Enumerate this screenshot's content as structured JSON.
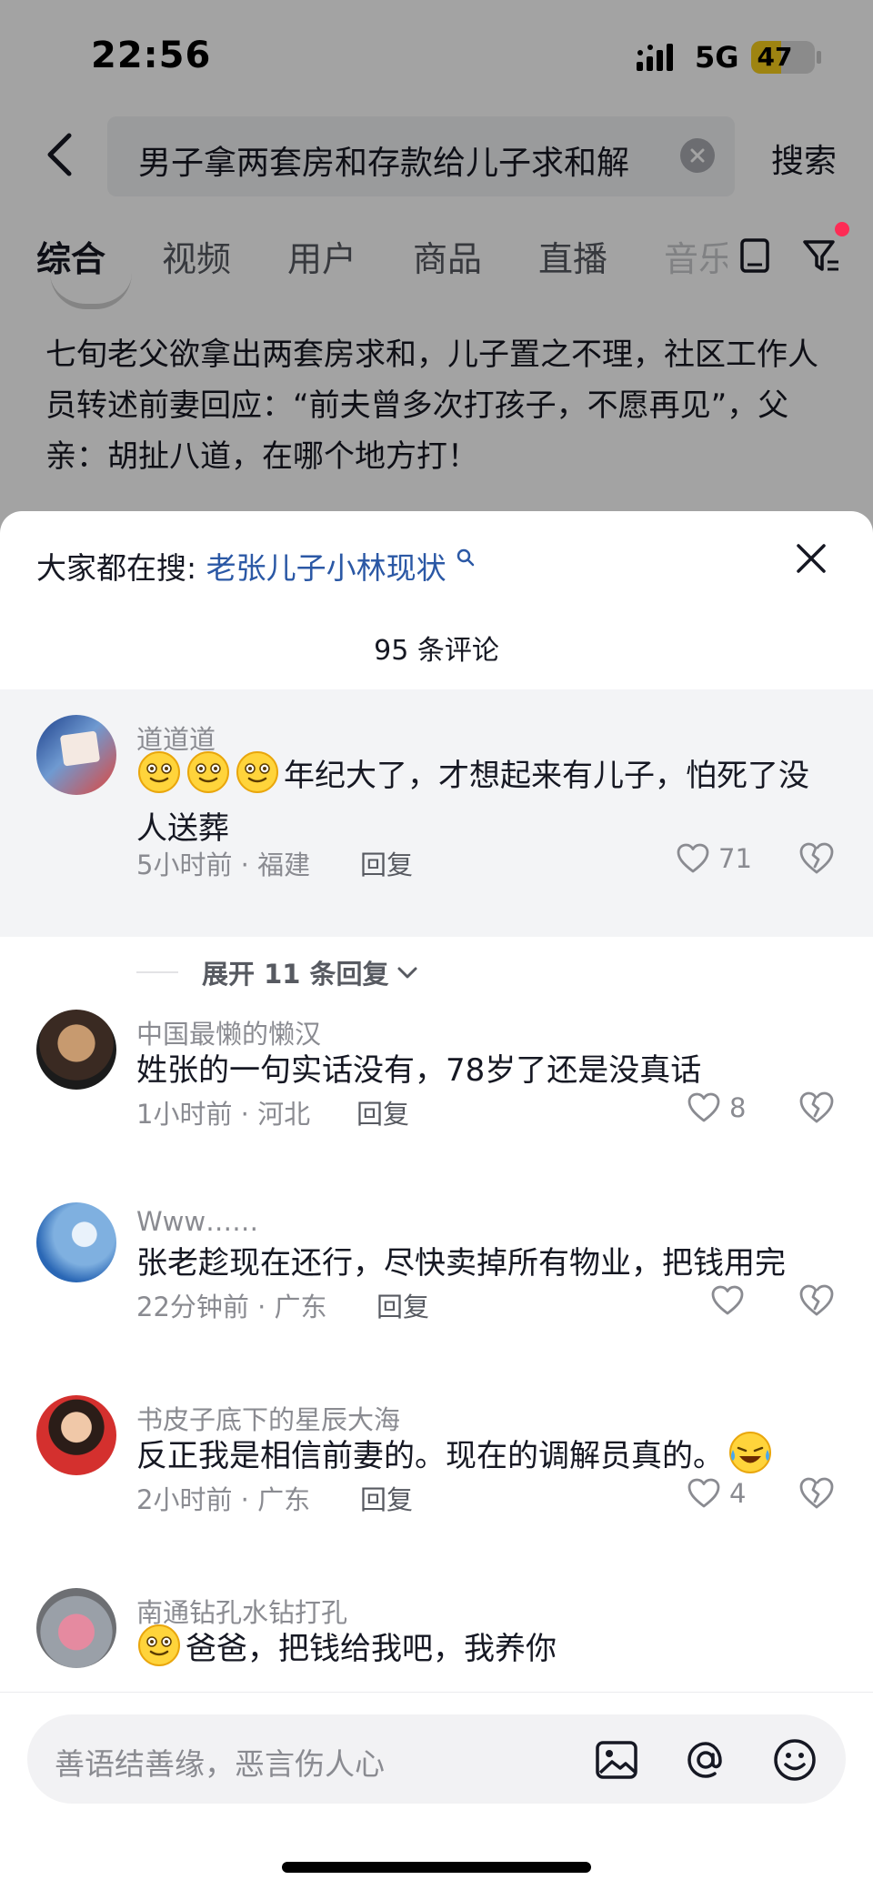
{
  "status_bar": {
    "time": "22:56",
    "network": "5G",
    "battery": "47",
    "battery_level": 0.47
  },
  "search": {
    "query": "男子拿两套房和存款给儿子求和解",
    "button": "搜索"
  },
  "tabs": [
    {
      "label": "综合",
      "active": true
    },
    {
      "label": "视频"
    },
    {
      "label": "用户"
    },
    {
      "label": "商品"
    },
    {
      "label": "直播"
    },
    {
      "label": "音乐"
    }
  ],
  "post": {
    "text": "七旬老父欲拿出两套房求和，儿子置之不理，社区工作人员转述前妻回应：“前夫曾多次打孩子，不愿再见”，父亲：胡扯八道，在哪个地方打！"
  },
  "sheet": {
    "trending_label": "大家都在搜:",
    "trending_link": "老张儿子小林现状",
    "comment_count": "95 条评论"
  },
  "comments": [
    {
      "user": "道道道",
      "text": "年纪大了，才想起来有儿子，怕死了没人送葬",
      "emoji_count": 3,
      "time": "5小时前 · 福建",
      "reply": "回复",
      "likes": "71"
    },
    {
      "user": "中国最懒的懒汉",
      "text": "姓张的一句实话没有，78岁了还是没真话",
      "time": "1小时前 · 河北",
      "reply": "回复",
      "likes": "8"
    },
    {
      "user": "Www……",
      "text": "张老趁现在还行，尽快卖掉所有物业，把钱用完",
      "time": "22分钟前 · 广东",
      "reply": "回复",
      "likes": ""
    },
    {
      "user": "书皮子底下的星辰大海",
      "text": "反正我是相信前妻的。现在的调解员真的。",
      "time": "2小时前 · 广东",
      "reply": "回复",
      "likes": "4"
    },
    {
      "user": "南通钻孔水钻打孔",
      "text": "爸爸，把钱给我吧，我养你"
    }
  ],
  "expand_replies": "展开 11 条回复",
  "input": {
    "placeholder": "善语结善缘，恶言伤人心"
  },
  "colors": {
    "accent_blue": "#2b58a5",
    "red_dot": "#fe2c55",
    "battery": "#f7cf1b"
  },
  "icons": [
    "back-icon",
    "clear-icon",
    "filter-icon",
    "tablet-icon",
    "search-small-icon",
    "close-icon",
    "heart-icon",
    "dislike-icon",
    "image-icon",
    "at-icon",
    "emoji-icon",
    "chevron-down-icon"
  ]
}
